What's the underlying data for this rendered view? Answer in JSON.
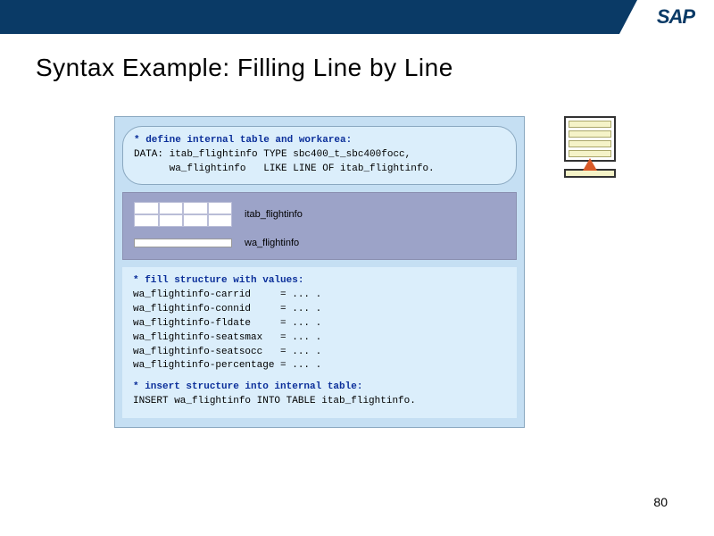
{
  "brand": "SAP",
  "title": "Syntax Example: Filling Line by Line",
  "page_number": "80",
  "bubble": {
    "comment": "* define internal table and workarea:",
    "line1": "DATA: itab_flightinfo TYPE sbc400_t_sbc400focc,",
    "line2": "      wa_flightinfo   LIKE LINE OF itab_flightinfo."
  },
  "tablevis": {
    "itab_label": "itab_flightinfo",
    "wa_label": "wa_flightinfo"
  },
  "codeblock": {
    "comment1": "* fill structure with values:",
    "l1": "wa_flightinfo-carrid     = ... .",
    "l2": "wa_flightinfo-connid     = ... .",
    "l3": "wa_flightinfo-fldate     = ... .",
    "l4": "wa_flightinfo-seatsmax   = ... .",
    "l5": "wa_flightinfo-seatsocc   = ... .",
    "l6": "wa_flightinfo-percentage = ... .",
    "comment2": "* insert structure into internal table:",
    "l7": "INSERT wa_flightinfo INTO TABLE itab_flightinfo."
  }
}
